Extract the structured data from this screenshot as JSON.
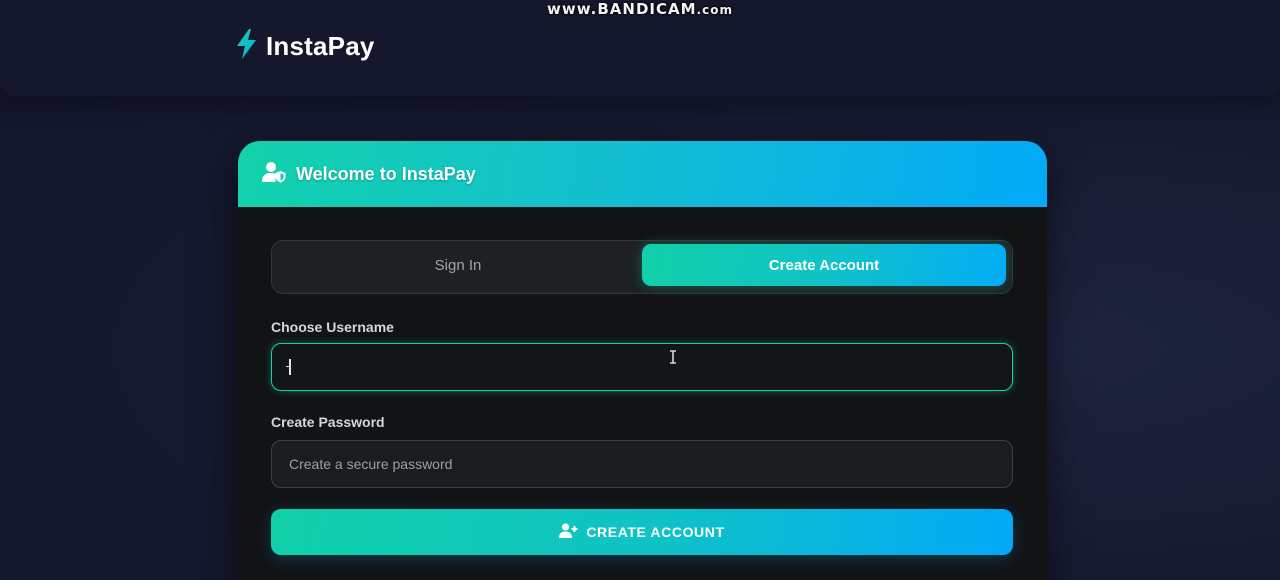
{
  "watermark": {
    "main": "www.BANDICAM",
    "suffix": ".com"
  },
  "app": {
    "name": "InstaPay",
    "logo_icon": "lightning-bolt-icon",
    "accent_color": "#12d2aa",
    "accent_color_2": "#03a9f7"
  },
  "card": {
    "title": "Welcome to InstaPay",
    "title_icon": "user-shield-icon"
  },
  "tabs": [
    {
      "label": "Sign In",
      "active": false
    },
    {
      "label": "Create Account",
      "active": true
    }
  ],
  "form": {
    "username": {
      "label": "Choose Username",
      "value": "",
      "placeholder": ""
    },
    "password": {
      "label": "Create Password",
      "value": "",
      "placeholder": "Create a secure password"
    },
    "submit": {
      "label": "CREATE ACCOUNT",
      "icon": "user-plus-icon"
    }
  }
}
